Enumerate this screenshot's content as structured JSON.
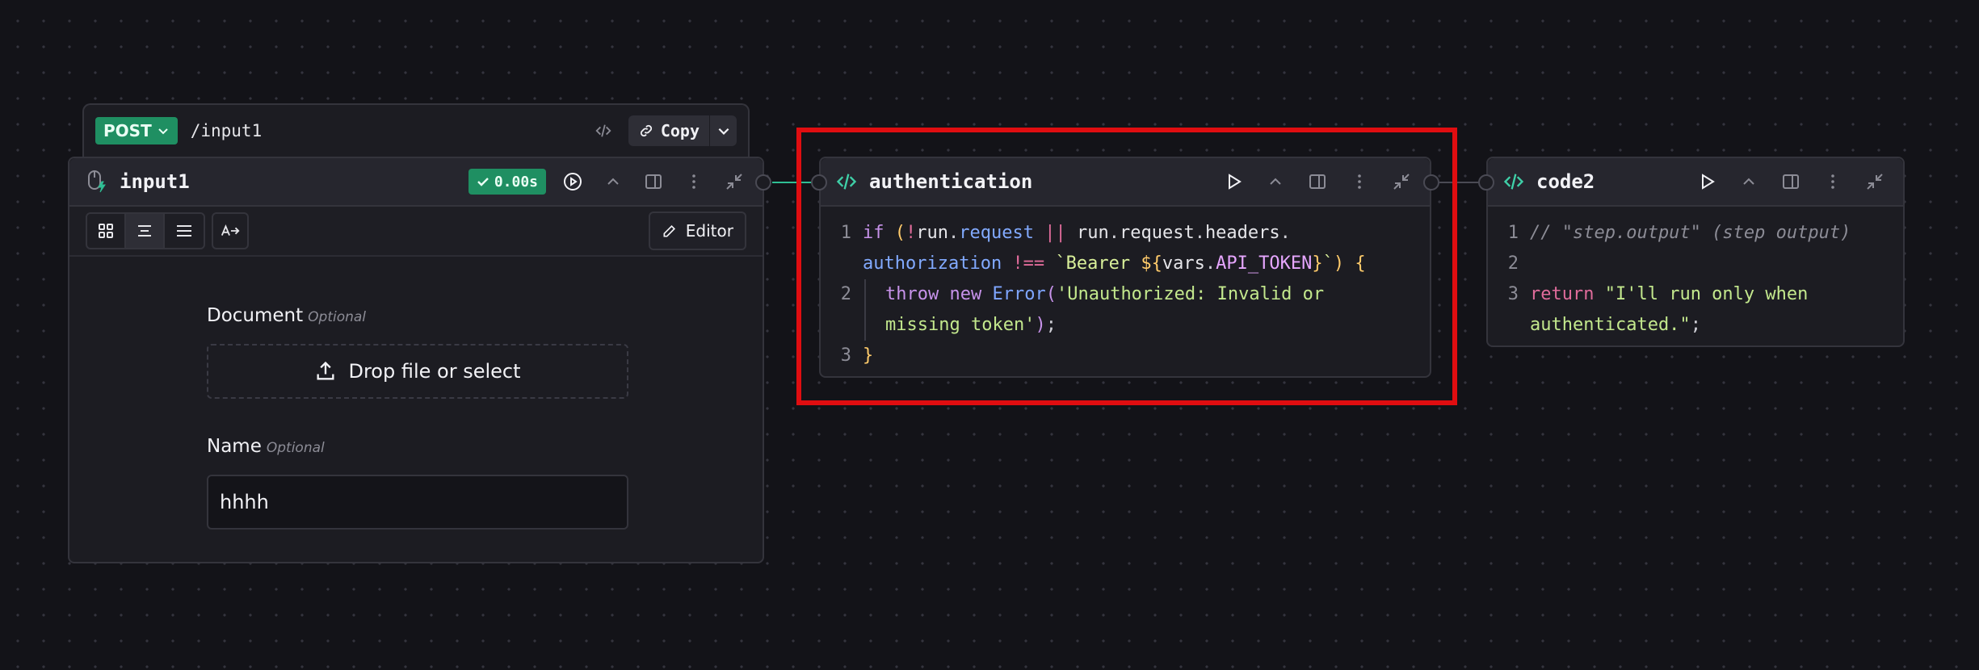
{
  "api_bar": {
    "method": "POST",
    "path": "/input1",
    "copy_label": "Copy"
  },
  "input_node": {
    "title": "input1",
    "duration": "0.00s",
    "editor_label": "Editor",
    "fields": [
      {
        "label": "Document",
        "optional": "Optional",
        "dropzone_text": "Drop file or select"
      },
      {
        "label": "Name",
        "optional": "Optional",
        "value": "hhhh"
      }
    ]
  },
  "auth_node": {
    "title": "authentication",
    "line_numbers": [
      "1",
      "2",
      "3"
    ]
  },
  "code2_node": {
    "title": "code2",
    "line_numbers": [
      "1",
      "2",
      "3"
    ]
  },
  "colors": {
    "accent_green": "#1f8f62",
    "code_icon": "#3fd0a8",
    "highlight_box": "#e00d10",
    "edge": "#2fbf94"
  }
}
